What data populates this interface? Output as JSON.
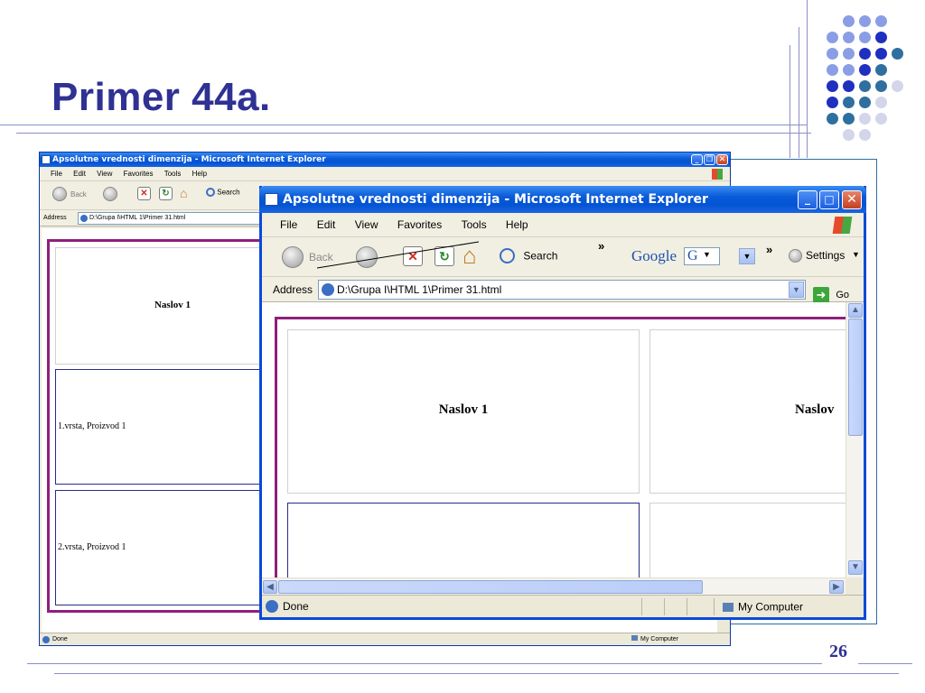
{
  "slide": {
    "title": "Primer 44a.",
    "page_number": "26",
    "accent_color": "#2f3193",
    "dot_colors": [
      "#8a9ee6",
      "#1f2fbf",
      "#2f6f9f",
      "#d3d6ea"
    ]
  },
  "window_back": {
    "title": "Apsolutne vrednosti dimenzija - Microsoft Internet Explorer",
    "menu": [
      "File",
      "Edit",
      "View",
      "Favorites",
      "Tools",
      "Help"
    ],
    "toolbar": {
      "back_label": "Back",
      "search_label": "Search"
    },
    "address_label": "Address",
    "address_value": "D:\\Grupa I\\HTML 1\\Primer 31.html",
    "cells": {
      "heading": "Naslov 1",
      "row1": "1.vrsta, Proizvod 1",
      "row2": "2.vrsta, Proizvod 1"
    },
    "status": {
      "left": "Done",
      "zone": "My Computer"
    }
  },
  "window_front": {
    "title": "Apsolutne vrednosti dimenzija - Microsoft Internet Explorer",
    "menu": [
      "File",
      "Edit",
      "View",
      "Favorites",
      "Tools",
      "Help"
    ],
    "toolbar": {
      "back_label": "Back",
      "search_label": "Search",
      "chevron": "»",
      "google_label": "Google",
      "google_g": "G",
      "settings_label": "Settings"
    },
    "address_label": "Address",
    "address_value": "D:\\Grupa I\\HTML 1\\Primer 31.html",
    "go_label": "Go",
    "cells": {
      "heading_left": "Naslov 1",
      "heading_right": "Naslov"
    },
    "status": {
      "left": "Done",
      "zone": "My Computer"
    }
  }
}
